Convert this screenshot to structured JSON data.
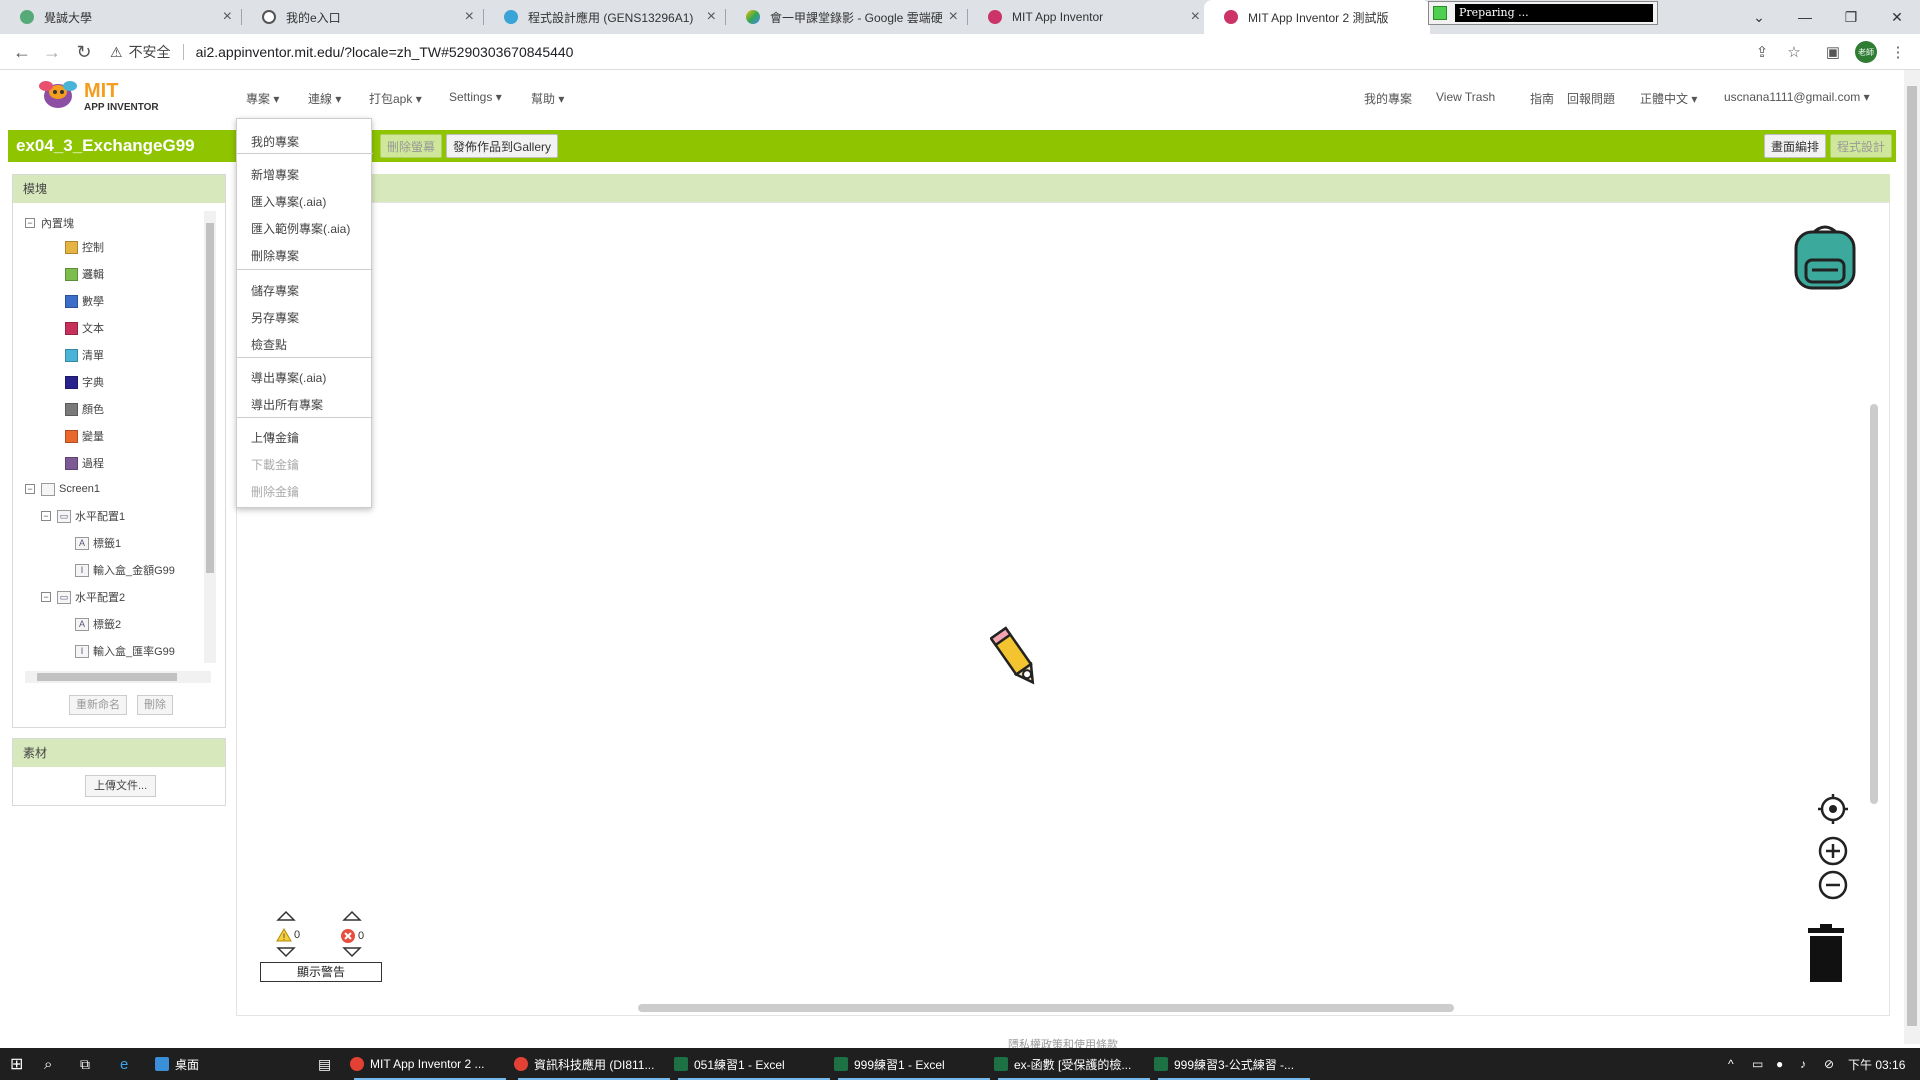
{
  "browser": {
    "tabs": [
      {
        "title": "覺誠大學",
        "active": false
      },
      {
        "title": "我的e入口",
        "active": false
      },
      {
        "title": "程式設計應用 (GENS13296A1)",
        "active": false
      },
      {
        "title": "會一甲課堂錄影 - Google 雲端硬",
        "active": false
      },
      {
        "title": "MIT App Inventor",
        "active": false
      },
      {
        "title": "MIT App Inventor 2 測試版",
        "active": true
      }
    ],
    "preparing_label": "Preparing ...",
    "insecure_label": "不安全",
    "url": "ai2.appinventor.mit.edu/?locale=zh_TW#5290303670845440",
    "profile_label": "老師"
  },
  "appinventor": {
    "logo_mit": "MIT",
    "logo_sub": "APP INVENTOR",
    "menus": [
      "專案",
      "連線",
      "打包apk",
      "Settings",
      "幫助"
    ],
    "right_menus": [
      "我的專案",
      "View Trash",
      "指南",
      "回報問題",
      "正體中文"
    ],
    "account": "uscnana1111@gmail.com"
  },
  "project": {
    "name": "ex04_3_ExchangeG99",
    "buttons": {
      "delete_screen": "刪除螢幕",
      "publish_gallery": "發佈作品到Gallery",
      "designer": "畫面編排",
      "blocks": "程式設計"
    }
  },
  "blocks_panel": {
    "title": "模塊",
    "builtin_label": "內置塊",
    "builtin": [
      {
        "label": "控制",
        "color": "#e5b443"
      },
      {
        "label": "邏輯",
        "color": "#7cbd4e"
      },
      {
        "label": "數學",
        "color": "#3c6ec9"
      },
      {
        "label": "文本",
        "color": "#c8305c"
      },
      {
        "label": "清單",
        "color": "#49b4d8"
      },
      {
        "label": "字典",
        "color": "#28238c"
      },
      {
        "label": "顏色",
        "color": "#7a7a7a"
      },
      {
        "label": "變量",
        "color": "#e8682e"
      },
      {
        "label": "過程",
        "color": "#7d5a96"
      }
    ],
    "screen": "Screen1",
    "components": [
      {
        "label": "水平配置1",
        "level": 1,
        "icon": "arrangement-icon"
      },
      {
        "label": "標籤1",
        "level": 2,
        "icon": "label-icon"
      },
      {
        "label": "輸入盒_金額G99",
        "level": 2,
        "icon": "textbox-icon"
      },
      {
        "label": "水平配置2",
        "level": 1,
        "icon": "arrangement-icon"
      },
      {
        "label": "標籤2",
        "level": 2,
        "icon": "label-icon"
      },
      {
        "label": "輸入盒_匯率G99",
        "level": 2,
        "icon": "textbox-icon"
      }
    ],
    "rename_button": "重新命名",
    "delete_button": "刪除"
  },
  "media_panel": {
    "title": "素材",
    "upload_button": "上傳文件..."
  },
  "dropdown": {
    "items": [
      {
        "label": "我的專案",
        "disabled": false
      },
      {
        "label": "新增專案",
        "disabled": false
      },
      {
        "label": "匯入專案(.aia)",
        "disabled": false
      },
      {
        "label": "匯入範例專案(.aia)",
        "disabled": false
      },
      {
        "label": "刪除專案",
        "disabled": false
      },
      {
        "label": "儲存專案",
        "disabled": false
      },
      {
        "label": "另存專案",
        "disabled": false
      },
      {
        "label": "檢查點",
        "disabled": false
      },
      {
        "label": "導出專案(.aia)",
        "disabled": false
      },
      {
        "label": "導出所有專案",
        "disabled": false
      },
      {
        "label": "上傳金鑰",
        "disabled": false
      },
      {
        "label": "下載金鑰",
        "disabled": true
      },
      {
        "label": "刪除金鑰",
        "disabled": true
      }
    ]
  },
  "workspace": {
    "warning_count": "0",
    "error_count": "0",
    "show_warnings_button": "顯示警告",
    "footer": "隱私權政策和使用條款"
  },
  "taskbar": {
    "items": [
      {
        "label": "桌面"
      },
      {
        "label": "MIT App Inventor 2 ..."
      },
      {
        "label": "資訊科技應用 (DI811..."
      },
      {
        "label": "051練習1 - Excel"
      },
      {
        "label": "999練習1 - Excel"
      },
      {
        "label": "ex-函數 [受保護的檢..."
      },
      {
        "label": "999練習3-公式練習 -..."
      }
    ],
    "time": "下午 03:16"
  }
}
